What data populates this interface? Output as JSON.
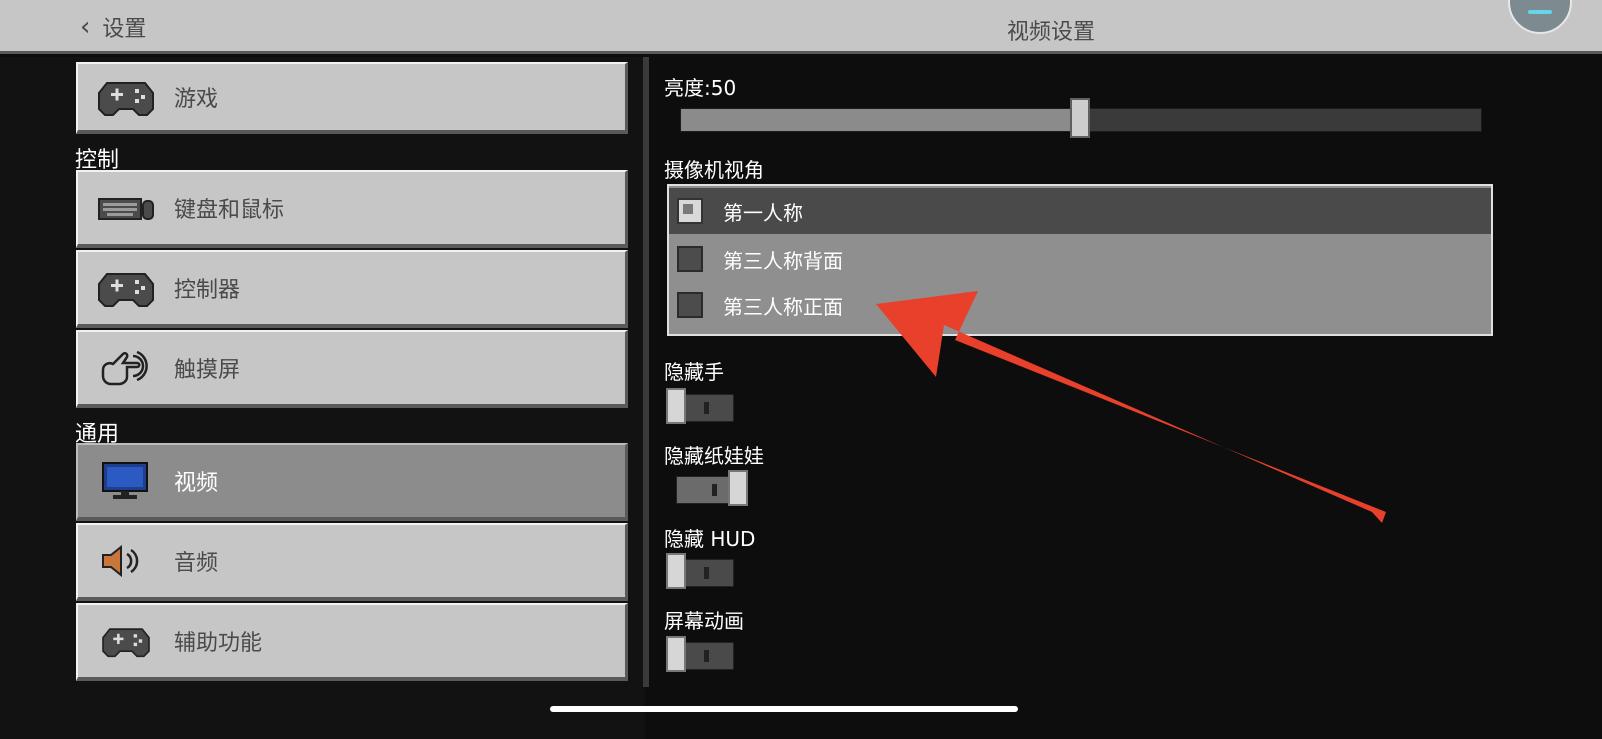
{
  "topbar": {
    "back_label": "设置",
    "title": "视频设置"
  },
  "sidebar": {
    "sections": [
      "控制",
      "通用"
    ],
    "items": [
      {
        "label": "游戏",
        "icon": "gamepad-icon"
      },
      {
        "label": "键盘和鼠标",
        "icon": "keyboard-mouse-icon"
      },
      {
        "label": "控制器",
        "icon": "gamepad-icon"
      },
      {
        "label": "触摸屏",
        "icon": "touch-hand-icon"
      },
      {
        "label": "视频",
        "icon": "monitor-icon",
        "selected": true
      },
      {
        "label": "音频",
        "icon": "speaker-icon"
      },
      {
        "label": "辅助功能",
        "icon": "gamepad-icon"
      }
    ]
  },
  "settings": {
    "brightness": {
      "label": "亮度:50",
      "value": 50,
      "max": 100
    },
    "camera": {
      "label": "摄像机视角",
      "options": [
        "第一人称",
        "第三人称背面",
        "第三人称正面"
      ],
      "selected": 0
    },
    "hide_hand": {
      "label": "隐藏手",
      "on": false
    },
    "hide_paperdoll": {
      "label": "隐藏纸娃娃",
      "on": true
    },
    "hide_hud": {
      "label": "隐藏 HUD",
      "on": false
    },
    "screen_anim": {
      "label": "屏幕动画",
      "on": false
    }
  },
  "annotation": {
    "arrow_color": "#e8402a"
  }
}
